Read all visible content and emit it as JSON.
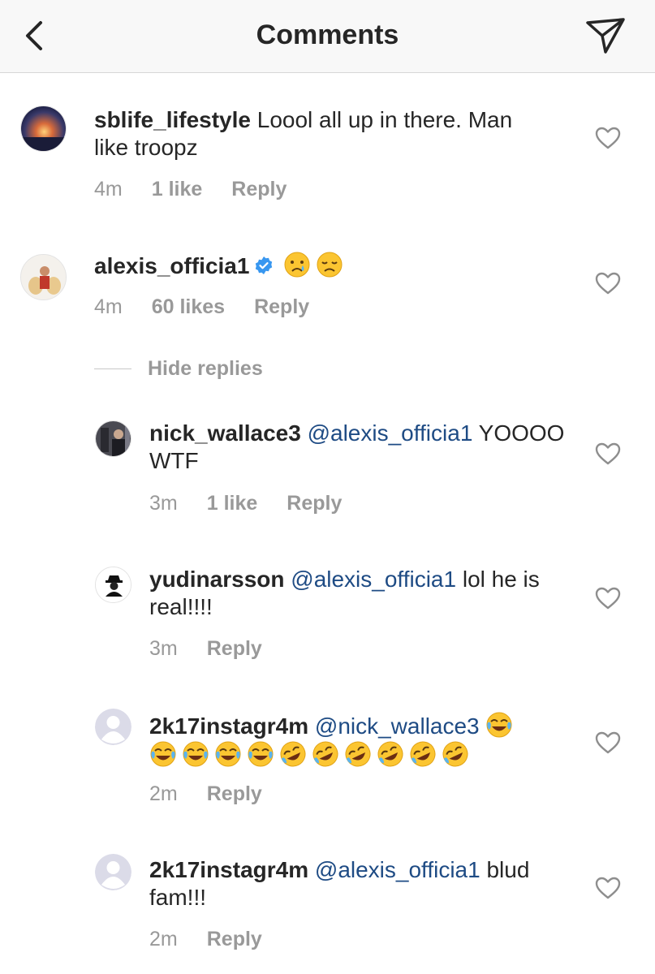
{
  "header": {
    "title": "Comments",
    "back_icon": "chevron-left-icon",
    "share_icon": "send-icon"
  },
  "comments": [
    {
      "username": "sblife_lifestyle",
      "text": "Loool all up in there. Man like troopz",
      "time": "4m",
      "likes": "1 like",
      "reply": "Reply"
    },
    {
      "username": "alexis_officia1",
      "verified": true,
      "emojis": [
        "crying-face",
        "disappointed-face"
      ],
      "time": "4m",
      "likes": "60 likes",
      "reply": "Reply",
      "hide_replies": "Hide replies"
    }
  ],
  "replies": [
    {
      "username": "nick_wallace3",
      "mention": "@alexis_officia1",
      "text": "YOOOO WTF",
      "time": "3m",
      "likes": "1 like",
      "reply": "Reply"
    },
    {
      "username": "yudinarsson",
      "mention": "@alexis_officia1",
      "text": "lol he is real!!!!",
      "time": "3m",
      "reply": "Reply"
    },
    {
      "username": "2k17instagr4m",
      "mention": "@nick_wallace3",
      "emojis": [
        "joy",
        "joy",
        "joy",
        "joy",
        "joy",
        "rofl",
        "rofl",
        "rofl",
        "rofl",
        "rofl",
        "rofl"
      ],
      "time": "2m",
      "reply": "Reply"
    },
    {
      "username": "2k17instagr4m",
      "mention": "@alexis_officia1",
      "text": "blud fam!!!",
      "time": "2m",
      "reply": "Reply"
    }
  ],
  "colors": {
    "mention": "#1e4b84",
    "meta": "#999999",
    "verified": "#3897f0",
    "header_bg": "#f8f8f8"
  }
}
